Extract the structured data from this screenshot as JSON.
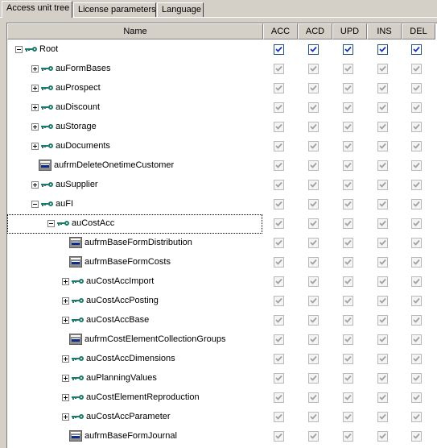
{
  "tabs": [
    {
      "label": "Access unit tree",
      "active": true
    },
    {
      "label": "License parameters",
      "active": false
    },
    {
      "label": "Language",
      "active": false
    }
  ],
  "columns": {
    "name": "Name",
    "perms": [
      "ACC",
      "ACD",
      "UPD",
      "INS",
      "DEL"
    ]
  },
  "colors": {
    "window_bg": "#d4d0c8",
    "grid_bg": "#ffffff",
    "key_icon": "#1f7a6e",
    "check_enabled": "#1c5180",
    "check_disabled": "#b9b9b9"
  },
  "rows": [
    {
      "label": "Root",
      "level": 0,
      "icon": "key-icon",
      "expander": "minus",
      "enabled": true,
      "checked": true
    },
    {
      "label": "auFormBases",
      "level": 1,
      "icon": "key-icon",
      "expander": "plus",
      "enabled": false,
      "checked": true
    },
    {
      "label": "auProspect",
      "level": 1,
      "icon": "key-icon",
      "expander": "plus",
      "enabled": false,
      "checked": true
    },
    {
      "label": "auDiscount",
      "level": 1,
      "icon": "key-icon",
      "expander": "plus",
      "enabled": false,
      "checked": true
    },
    {
      "label": "auStorage",
      "level": 1,
      "icon": "key-icon",
      "expander": "plus",
      "enabled": false,
      "checked": true
    },
    {
      "label": "auDocuments",
      "level": 1,
      "icon": "key-icon",
      "expander": "plus",
      "enabled": false,
      "checked": true
    },
    {
      "label": "aufrmDeleteOnetimeCustomer",
      "level": 1,
      "icon": "form-icon",
      "expander": "none",
      "enabled": false,
      "checked": true
    },
    {
      "label": "auSupplier",
      "level": 1,
      "icon": "key-icon",
      "expander": "plus",
      "enabled": false,
      "checked": true
    },
    {
      "label": "auFI",
      "level": 1,
      "icon": "key-icon",
      "expander": "minus",
      "enabled": false,
      "checked": true
    },
    {
      "label": "auCostAcc",
      "level": 2,
      "icon": "key-icon",
      "expander": "minus",
      "enabled": false,
      "checked": true,
      "focused": true
    },
    {
      "label": "aufrmBaseFormDistribution",
      "level": 3,
      "icon": "form-icon",
      "expander": "none",
      "enabled": false,
      "checked": true
    },
    {
      "label": "aufrmBaseFormCosts",
      "level": 3,
      "icon": "form-icon",
      "expander": "none",
      "enabled": false,
      "checked": true
    },
    {
      "label": "auCostAccImport",
      "level": 3,
      "icon": "key-icon",
      "expander": "plus",
      "enabled": false,
      "checked": true
    },
    {
      "label": "auCostAccPosting",
      "level": 3,
      "icon": "key-icon",
      "expander": "plus",
      "enabled": false,
      "checked": true
    },
    {
      "label": "auCostAccBase",
      "level": 3,
      "icon": "key-icon",
      "expander": "plus",
      "enabled": false,
      "checked": true
    },
    {
      "label": "aufrmCostElementCollectionGroups",
      "level": 3,
      "icon": "form-icon",
      "expander": "none",
      "enabled": false,
      "checked": true
    },
    {
      "label": "auCostAccDimensions",
      "level": 3,
      "icon": "key-icon",
      "expander": "plus",
      "enabled": false,
      "checked": true
    },
    {
      "label": "auPlanningValues",
      "level": 3,
      "icon": "key-icon",
      "expander": "plus",
      "enabled": false,
      "checked": true
    },
    {
      "label": "auCostElementReproduction",
      "level": 3,
      "icon": "key-icon",
      "expander": "plus",
      "enabled": false,
      "checked": true
    },
    {
      "label": "auCostAccParameter",
      "level": 3,
      "icon": "key-icon",
      "expander": "plus",
      "enabled": false,
      "checked": true
    },
    {
      "label": "aufrmBaseFormJournal",
      "level": 3,
      "icon": "form-icon",
      "expander": "none",
      "enabled": false,
      "checked": true
    }
  ]
}
